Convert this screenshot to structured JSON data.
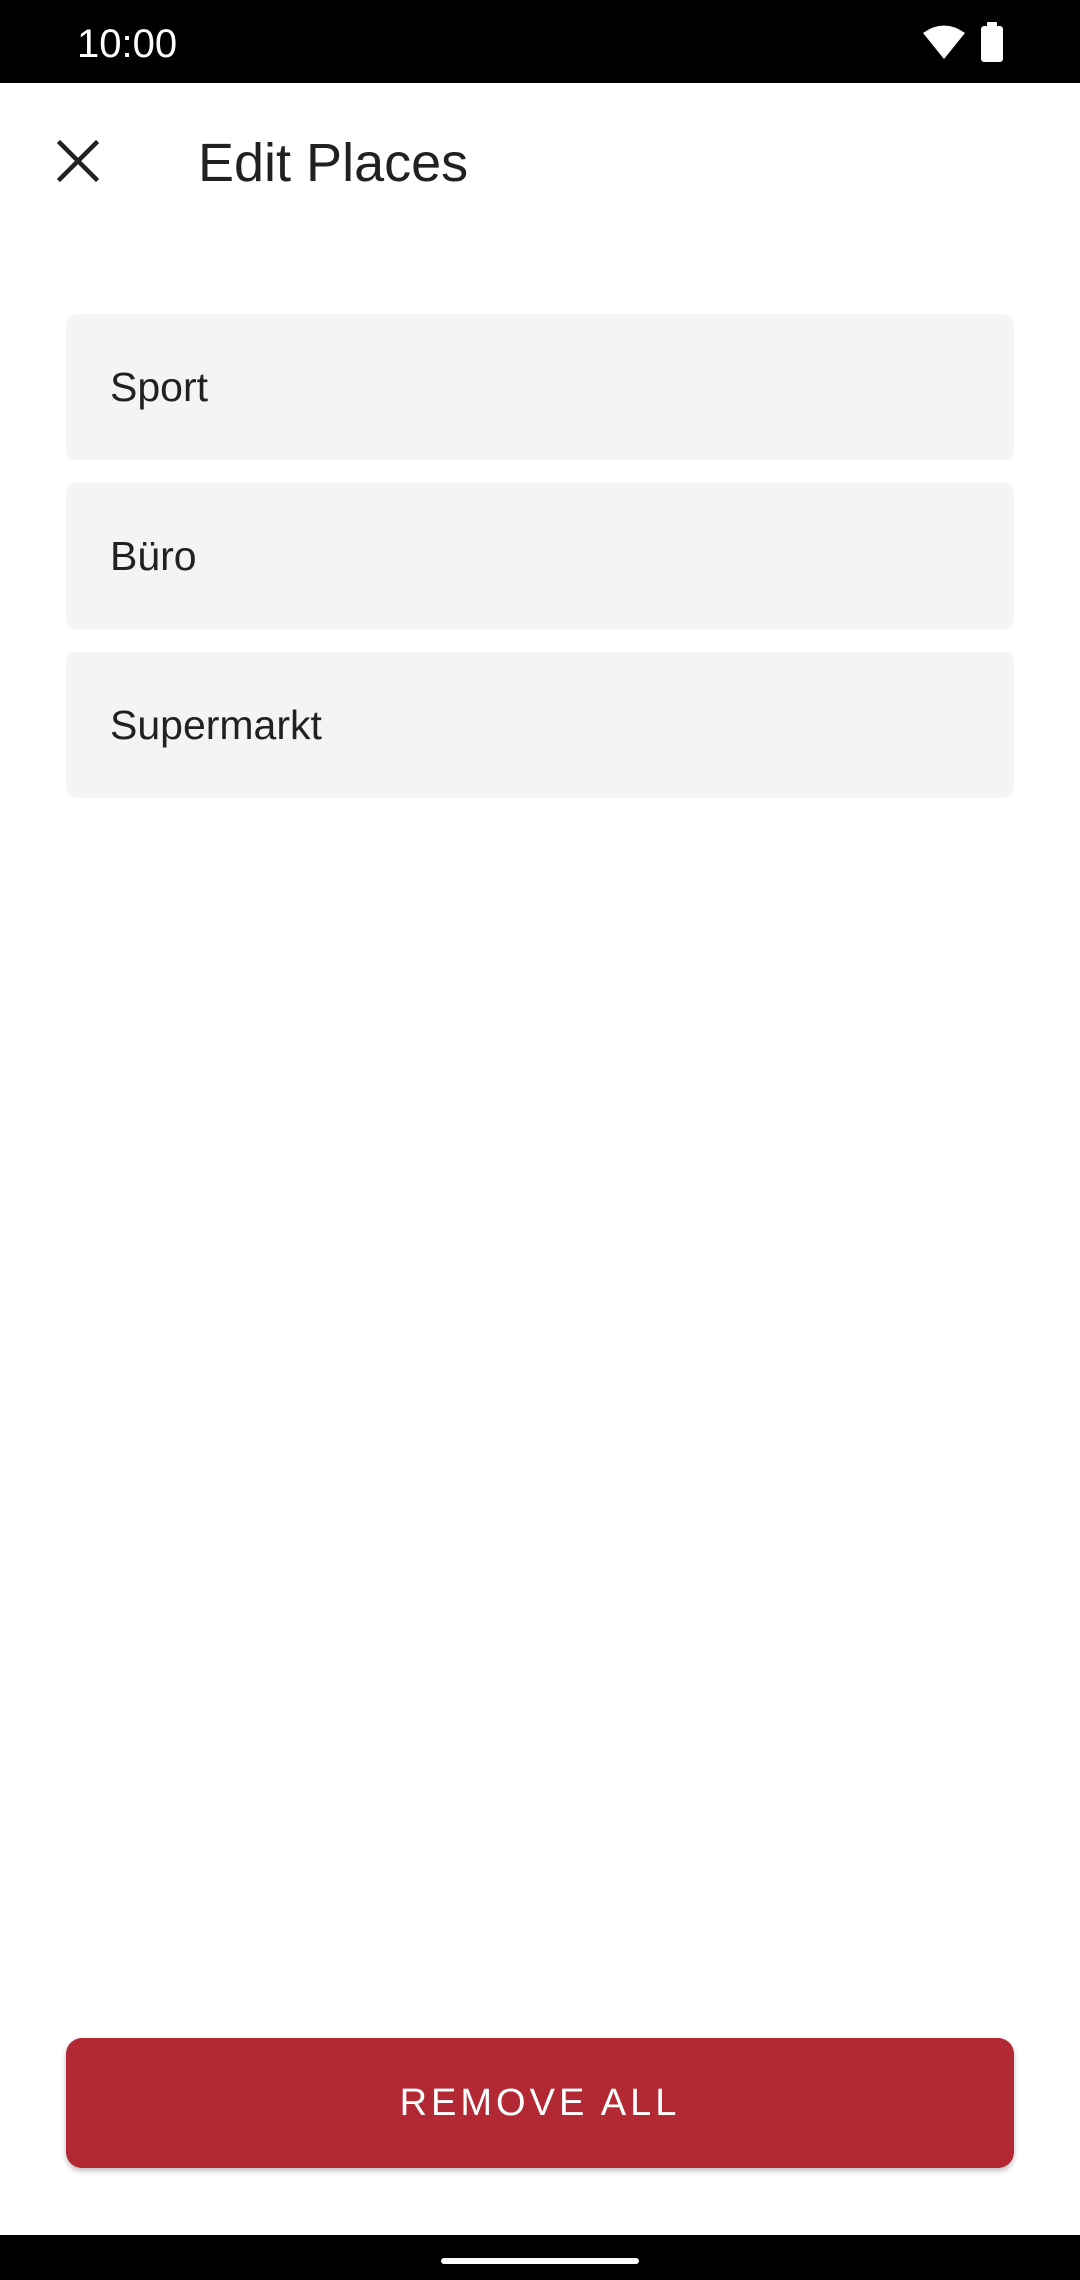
{
  "status_bar": {
    "time": "10:00",
    "icons": [
      "wifi-icon",
      "battery-icon"
    ]
  },
  "app_bar": {
    "close_icon": "close-icon",
    "title": "Edit Places"
  },
  "places": [
    {
      "name": "Sport"
    },
    {
      "name": "Büro"
    },
    {
      "name": "Supermarkt"
    }
  ],
  "actions": {
    "remove_all_label": "REMOVE ALL"
  },
  "colors": {
    "accent": "#b22934",
    "list_item_bg": "#f4f4f4",
    "text": "#212121"
  }
}
